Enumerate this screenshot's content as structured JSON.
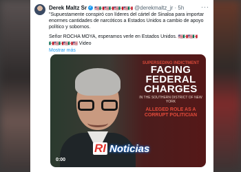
{
  "tweet": {
    "author_name": "Derek Maltz Sr",
    "handle_time": "@derekmaltz_jr · 5h",
    "more_label": "···",
    "flags_line1": "🇺🇸🇲🇽🇺🇸🇲🇽🇺🇸🇲🇽🇺🇸🇲🇽",
    "text_line1": "\"Supuestamente conspiró con líderes del cártel de Sinaloa para importar enormes cantidades de narcóticos a Estados Unidos a cambio de apoyo político y sobornos.",
    "text_line2": "Señor ROCHA MOYA, esperamos verle en Estados Unidos.",
    "flags_line2": "🇺🇸🇲🇽🇺🇸🇲🇽",
    "flags_line3": "🇲🇽🇺🇸🇲🇽🇺🇸🇲🇽🇺🇸",
    "video_label": "Video",
    "show_more": "Mostrar más"
  },
  "media": {
    "headline_top": "SUPERSEDING INDICTMENT",
    "headline_main": "FACING FEDERAL CHARGES",
    "headline_sub": "IN THE SOUTHERN DISTRICT OF NEW YORK",
    "headline_red": "ALLEGED ROLE AS A CORRUPT POLITICIAN",
    "brand_mark": "RI",
    "brand_word": "Noticias",
    "timestamp": "0:00"
  }
}
